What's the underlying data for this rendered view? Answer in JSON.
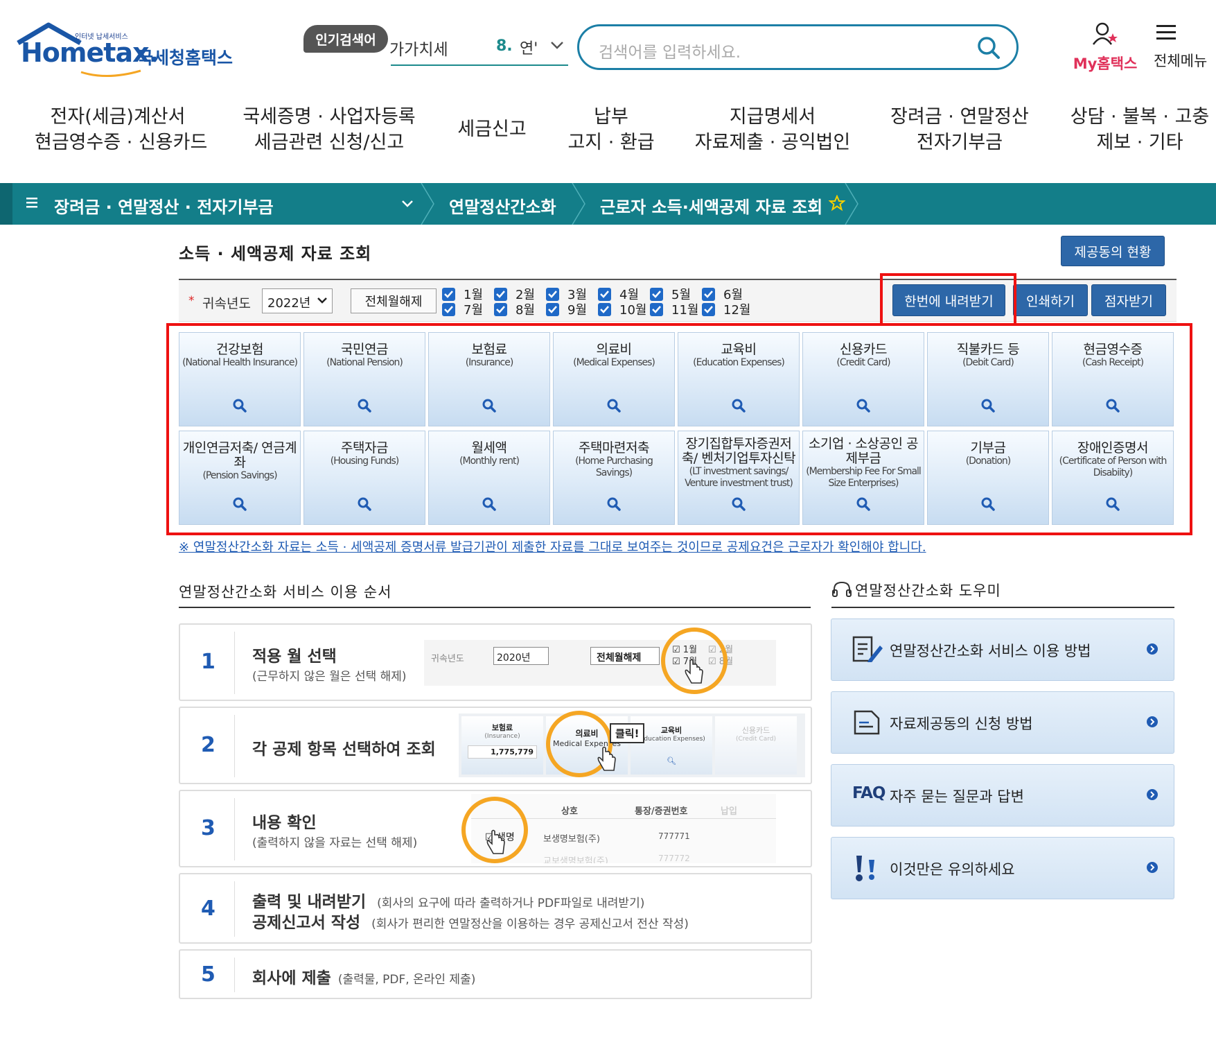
{
  "header": {
    "logo_tagline": "인터넷 납세서비스",
    "logo_text": "Hometax.",
    "logo_ko": "국세청홈택스",
    "popular_badge": "인기검색어",
    "popular_term": "가가치세",
    "popular_rank": "8.",
    "popular_rank_term": "연'",
    "search_placeholder": "검색어를 입력하세요.",
    "my_hometax": "My홈택스",
    "all_menu": "전체메뉴"
  },
  "gnb": [
    {
      "line1": "전자(세금)계산서",
      "line2": "현금영수증 · 신용카드"
    },
    {
      "line1": "국세증명 · 사업자등록",
      "line2": "세금관련 신청/신고"
    },
    {
      "line1": "세금신고",
      "line2": ""
    },
    {
      "line1": "납부",
      "line2": "고지 · 환급"
    },
    {
      "line1": "지급명세서",
      "line2": "자료제출 · 공익법인"
    },
    {
      "line1": "장려금 · 연말정산",
      "line2": "전자기부금"
    },
    {
      "line1": "상담 · 불복 · 고충",
      "line2": "제보 · 기타"
    }
  ],
  "breadcrumb": {
    "level1": "장려금 · 연말정산 · 전자기부금",
    "level2": "연말정산간소화",
    "level3": "근로자 소득·세액공제 자료 조회"
  },
  "page": {
    "title": "소득 · 세액공제 자료 조회",
    "status_button": "제공동의 현황"
  },
  "filter": {
    "required_mark": "*",
    "year_label": "귀속년도",
    "year_value": "2022년",
    "clear_all": "전체월해제",
    "months": [
      "1월",
      "2월",
      "3월",
      "4월",
      "5월",
      "6월",
      "7월",
      "8월",
      "9월",
      "10월",
      "11월",
      "12월"
    ],
    "download_all": "한번에 내려받기",
    "print": "인쇄하기",
    "braille": "점자받기"
  },
  "tiles": [
    {
      "ko": "건강보험",
      "en": "(National Health Insurance)"
    },
    {
      "ko": "국민연금",
      "en": "(National Pension)"
    },
    {
      "ko": "보험료",
      "en": "(Insurance)"
    },
    {
      "ko": "의료비",
      "en": "(Medical Expenses)"
    },
    {
      "ko": "교육비",
      "en": "(Education Expenses)"
    },
    {
      "ko": "신용카드",
      "en": "(Credit Card)"
    },
    {
      "ko": "직불카드 등",
      "en": "(Debit Card)"
    },
    {
      "ko": "현금영수증",
      "en": "(Cash Receipt)"
    },
    {
      "ko": "개인연금저축/ 연금계좌",
      "en": "(Pension Savings)"
    },
    {
      "ko": "주택자금",
      "en": "(Housing Funds)"
    },
    {
      "ko": "월세액",
      "en": "(Monthly rent)"
    },
    {
      "ko": "주택마련저축",
      "en": "(Home Purchasing Savings)"
    },
    {
      "ko": "장기집합투자증권저축/ 벤처기업투자신탁",
      "en": "(LT investment savings/ Venture investment trust)"
    },
    {
      "ko": "소기업 · 소상공인 공제부금",
      "en": "(Membership Fee For Small Size Enterprises)"
    },
    {
      "ko": "기부금",
      "en": "(Donation)"
    },
    {
      "ko": "장애인증명서",
      "en": "(Certificate of Person with Disabiity)"
    }
  ],
  "notice": "※ 연말정산간소화 자료는 소득 · 세액공제 증명서류 발급기관이 제출한 자료를 그대로 보여주는 것이므로 공제요건은 근로자가 확인해야 합니다.",
  "steps_section": {
    "title": "연말정산간소화 서비스 이용 순서",
    "steps": [
      {
        "num": "1",
        "title": "적용 월 선택",
        "sub": "(근무하지 않은 월은 선택 해제)"
      },
      {
        "num": "2",
        "title": "각 공제 항목 선택하여 조회",
        "sub": ""
      },
      {
        "num": "3",
        "title": "내용 확인",
        "sub": "(출력하지 않을 자료는 선택 해제)"
      },
      {
        "num": "4",
        "title": "출력 및 내려받기",
        "note": "(회사의 요구에 따라 출력하거나 PDF파일로 내려받기)",
        "title2": "공제신고서 작성",
        "note2": "(회사가 편리한 연말정산을 이용하는 경우 공제신고서 전산 작성)"
      },
      {
        "num": "5",
        "title": "회사에 제출",
        "note": "(출력물, PDF, 온라인 제출)"
      }
    ],
    "preview1": {
      "year_label": "귀속년도",
      "year_value": "2020년",
      "clear_all": "전체월해제",
      "m1": "1월",
      "m7": "7월",
      "m2": "2월",
      "m8": "8월"
    },
    "preview2": {
      "t1": "보험료",
      "t1en": "(Insurance)",
      "t1val": "1,775,779",
      "t2": "의료비",
      "t2en": "Medical Expenses",
      "t3": "교육비",
      "t3en": "(Education Expenses)",
      "t4": "신용카드",
      "t4en": "(Credit Card)",
      "click": "클릭!"
    },
    "preview3": {
      "col1": "상호",
      "col2": "통장/증권번호",
      "col3": "납입",
      "row1_name": "생명",
      "row1_company": "보생명보험(주)",
      "row1_no": "777771",
      "row2_company": "교보생명보험(주)",
      "row2_no": "777772"
    }
  },
  "help_section": {
    "title": "연말정산간소화 도우미",
    "items": [
      {
        "label": "연말정산간소화 서비스 이용 방법",
        "icon": "document-pen-icon"
      },
      {
        "label": "자료제공동의 신청 방법",
        "icon": "document-icon"
      },
      {
        "label": "자주 묻는 질문과 답변",
        "prefix": "FAQ",
        "icon": "faq-icon"
      },
      {
        "label": "이것만은 유의하세요",
        "icon": "exclamation-icon"
      }
    ]
  }
}
